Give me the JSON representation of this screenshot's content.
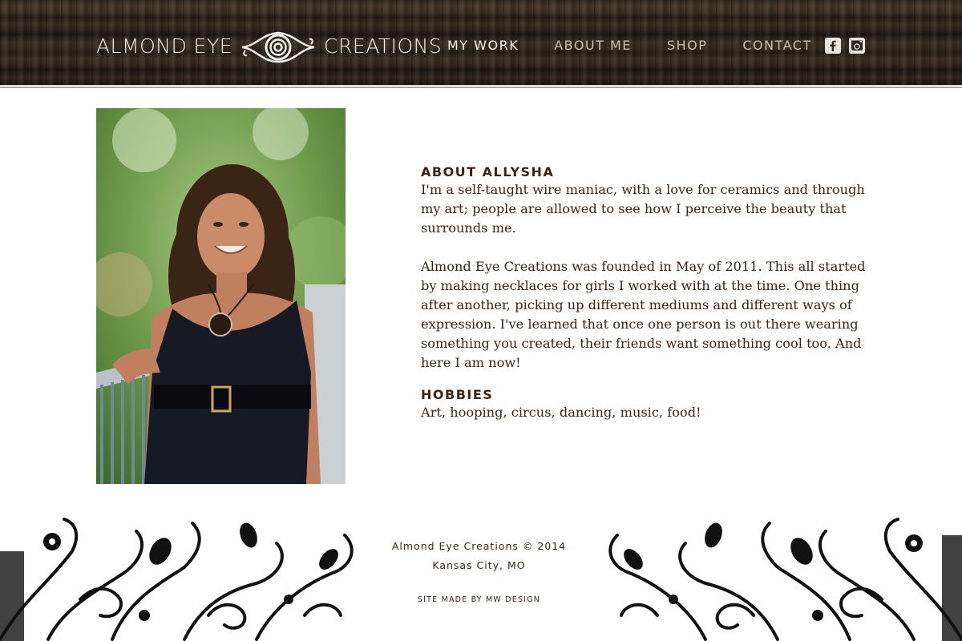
{
  "brand": {
    "name_left": "ALMOND EYE",
    "name_right": "CREATIONS",
    "logo_icon": "spiral-eye-logo"
  },
  "nav": {
    "items": [
      {
        "label": "MY WORK",
        "active": true
      },
      {
        "label": "ABOUT ME",
        "active": false
      },
      {
        "label": "SHOP",
        "active": false
      },
      {
        "label": "CONTACT",
        "active": false
      }
    ]
  },
  "social": {
    "facebook_icon": "facebook-icon",
    "instagram_icon": "instagram-icon"
  },
  "about": {
    "heading": "ABOUT ALLYSHA",
    "paragraph_1": "I'm a self-taught wire maniac, with a love for ceramics and through my art; people are allowed to see how I perceive the beauty that surrounds me.",
    "paragraph_2": "Almond Eye Creations was founded in May of 2011. This all started by making necklaces for girls I worked with at the time. One thing after an­other, picking up different mediums and different ways of expression. I've learned that once one person is out there wearing something you created, their friends want something cool too. And here I am now!"
  },
  "hobbies": {
    "heading": "HOBBIES",
    "text": "Art, hooping, circus, dancing, music, food!"
  },
  "footer": {
    "copyright": "Almond Eye Creations © 2014",
    "location": "Kansas City, MO",
    "credit": "SITE MADE BY MW DESIGN"
  },
  "colors": {
    "text_brown": "#3b2416",
    "header_wood": "#2e241b",
    "nav_active": "#f7f3ee",
    "nav_inactive": "#c9bfb1"
  }
}
